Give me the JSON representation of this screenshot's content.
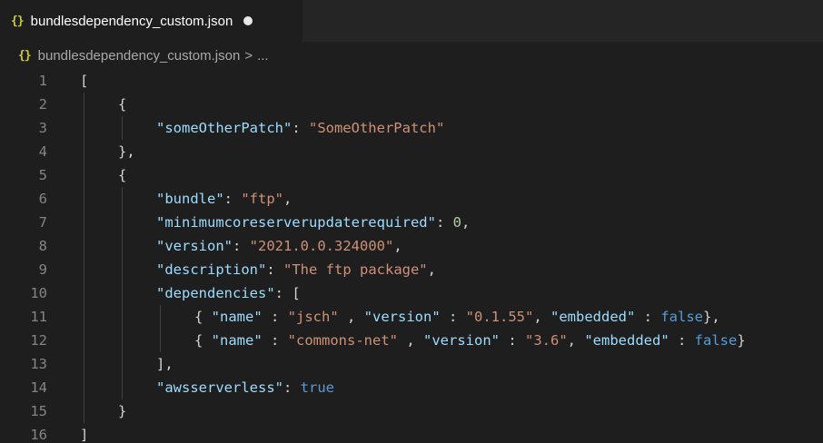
{
  "tab": {
    "title": "bundlesdependency_custom.json",
    "icon": "json-icon"
  },
  "breadcrumb": {
    "file": "bundlesdependency_custom.json",
    "separator": ">",
    "more": "..."
  },
  "colors": {
    "background": "#1e1e1e",
    "key": "#9cdcfe",
    "string": "#ce9178",
    "number": "#b5cea8",
    "boolean": "#569cd6",
    "punct": "#d4d4d4",
    "lineNumber": "#858585"
  },
  "lines": [
    {
      "n": "1",
      "indent": 0,
      "tokens": [
        [
          "p",
          "["
        ]
      ]
    },
    {
      "n": "2",
      "indent": 1,
      "tokens": [
        [
          "p",
          "{"
        ]
      ]
    },
    {
      "n": "3",
      "indent": 2,
      "tokens": [
        [
          "k",
          "\"someOtherPatch\""
        ],
        [
          "p",
          ": "
        ],
        [
          "s",
          "\"SomeOtherPatch\""
        ]
      ]
    },
    {
      "n": "4",
      "indent": 1,
      "tokens": [
        [
          "p",
          "},"
        ]
      ]
    },
    {
      "n": "5",
      "indent": 1,
      "tokens": [
        [
          "p",
          "{"
        ]
      ]
    },
    {
      "n": "6",
      "indent": 2,
      "tokens": [
        [
          "k",
          "\"bundle\""
        ],
        [
          "p",
          ": "
        ],
        [
          "s",
          "\"ftp\""
        ],
        [
          "p",
          ","
        ]
      ]
    },
    {
      "n": "7",
      "indent": 2,
      "tokens": [
        [
          "k",
          "\"minimumcoreserverupdaterequired\""
        ],
        [
          "p",
          ": "
        ],
        [
          "n",
          "0"
        ],
        [
          "p",
          ","
        ]
      ]
    },
    {
      "n": "8",
      "indent": 2,
      "tokens": [
        [
          "k",
          "\"version\""
        ],
        [
          "p",
          ": "
        ],
        [
          "s",
          "\"2021.0.0.324000\""
        ],
        [
          "p",
          ","
        ]
      ]
    },
    {
      "n": "9",
      "indent": 2,
      "tokens": [
        [
          "k",
          "\"description\""
        ],
        [
          "p",
          ": "
        ],
        [
          "s",
          "\"The ftp package\""
        ],
        [
          "p",
          ","
        ]
      ]
    },
    {
      "n": "10",
      "indent": 2,
      "tokens": [
        [
          "k",
          "\"dependencies\""
        ],
        [
          "p",
          ": ["
        ]
      ]
    },
    {
      "n": "11",
      "indent": 3,
      "tokens": [
        [
          "p",
          "{ "
        ],
        [
          "k",
          "\"name\""
        ],
        [
          "p",
          " : "
        ],
        [
          "s",
          "\"jsch\""
        ],
        [
          "p",
          " , "
        ],
        [
          "k",
          "\"version\""
        ],
        [
          "p",
          " : "
        ],
        [
          "s",
          "\"0.1.55\""
        ],
        [
          "p",
          ", "
        ],
        [
          "k",
          "\"embedded\""
        ],
        [
          "p",
          " : "
        ],
        [
          "b",
          "false"
        ],
        [
          "p",
          "},"
        ]
      ]
    },
    {
      "n": "12",
      "indent": 3,
      "tokens": [
        [
          "p",
          "{ "
        ],
        [
          "k",
          "\"name\""
        ],
        [
          "p",
          " : "
        ],
        [
          "s",
          "\"commons-net\""
        ],
        [
          "p",
          " , "
        ],
        [
          "k",
          "\"version\""
        ],
        [
          "p",
          " : "
        ],
        [
          "s",
          "\"3.6\""
        ],
        [
          "p",
          ", "
        ],
        [
          "k",
          "\"embedded\""
        ],
        [
          "p",
          " : "
        ],
        [
          "b",
          "false"
        ],
        [
          "p",
          "}"
        ]
      ]
    },
    {
      "n": "13",
      "indent": 2,
      "tokens": [
        [
          "p",
          "],"
        ]
      ]
    },
    {
      "n": "14",
      "indent": 2,
      "tokens": [
        [
          "k",
          "\"awsserverless\""
        ],
        [
          "p",
          ": "
        ],
        [
          "b",
          "true"
        ]
      ]
    },
    {
      "n": "15",
      "indent": 1,
      "tokens": [
        [
          "p",
          "}"
        ]
      ]
    },
    {
      "n": "16",
      "indent": 0,
      "tokens": [
        [
          "p",
          "]"
        ]
      ]
    }
  ]
}
